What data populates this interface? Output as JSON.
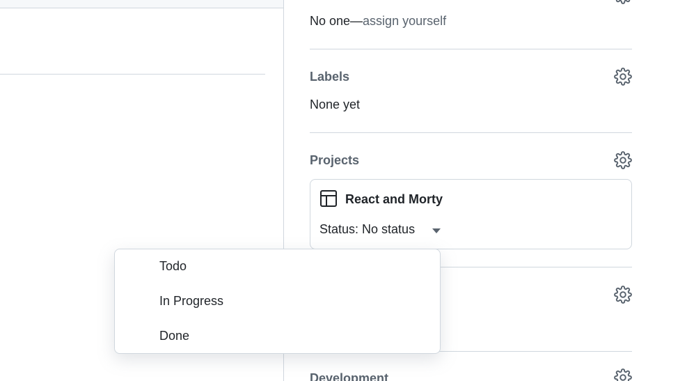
{
  "sidebar": {
    "assignees": {
      "value": "No one—",
      "assign_link": "assign yourself"
    },
    "labels": {
      "title": "Labels",
      "value": "None yet"
    },
    "projects": {
      "title": "Projects",
      "card": {
        "icon": "table-icon",
        "name": "React and Morty",
        "status_text": "Status: No status"
      }
    },
    "hidden_section": {
      "icon": "gear-icon"
    },
    "development": {
      "title": "Development"
    }
  },
  "status_dropdown": {
    "options": [
      "Todo",
      "In Progress",
      "Done"
    ]
  },
  "colors": {
    "muted_text": "#59636e",
    "border": "#d0d7de",
    "text": "#1f2328"
  }
}
